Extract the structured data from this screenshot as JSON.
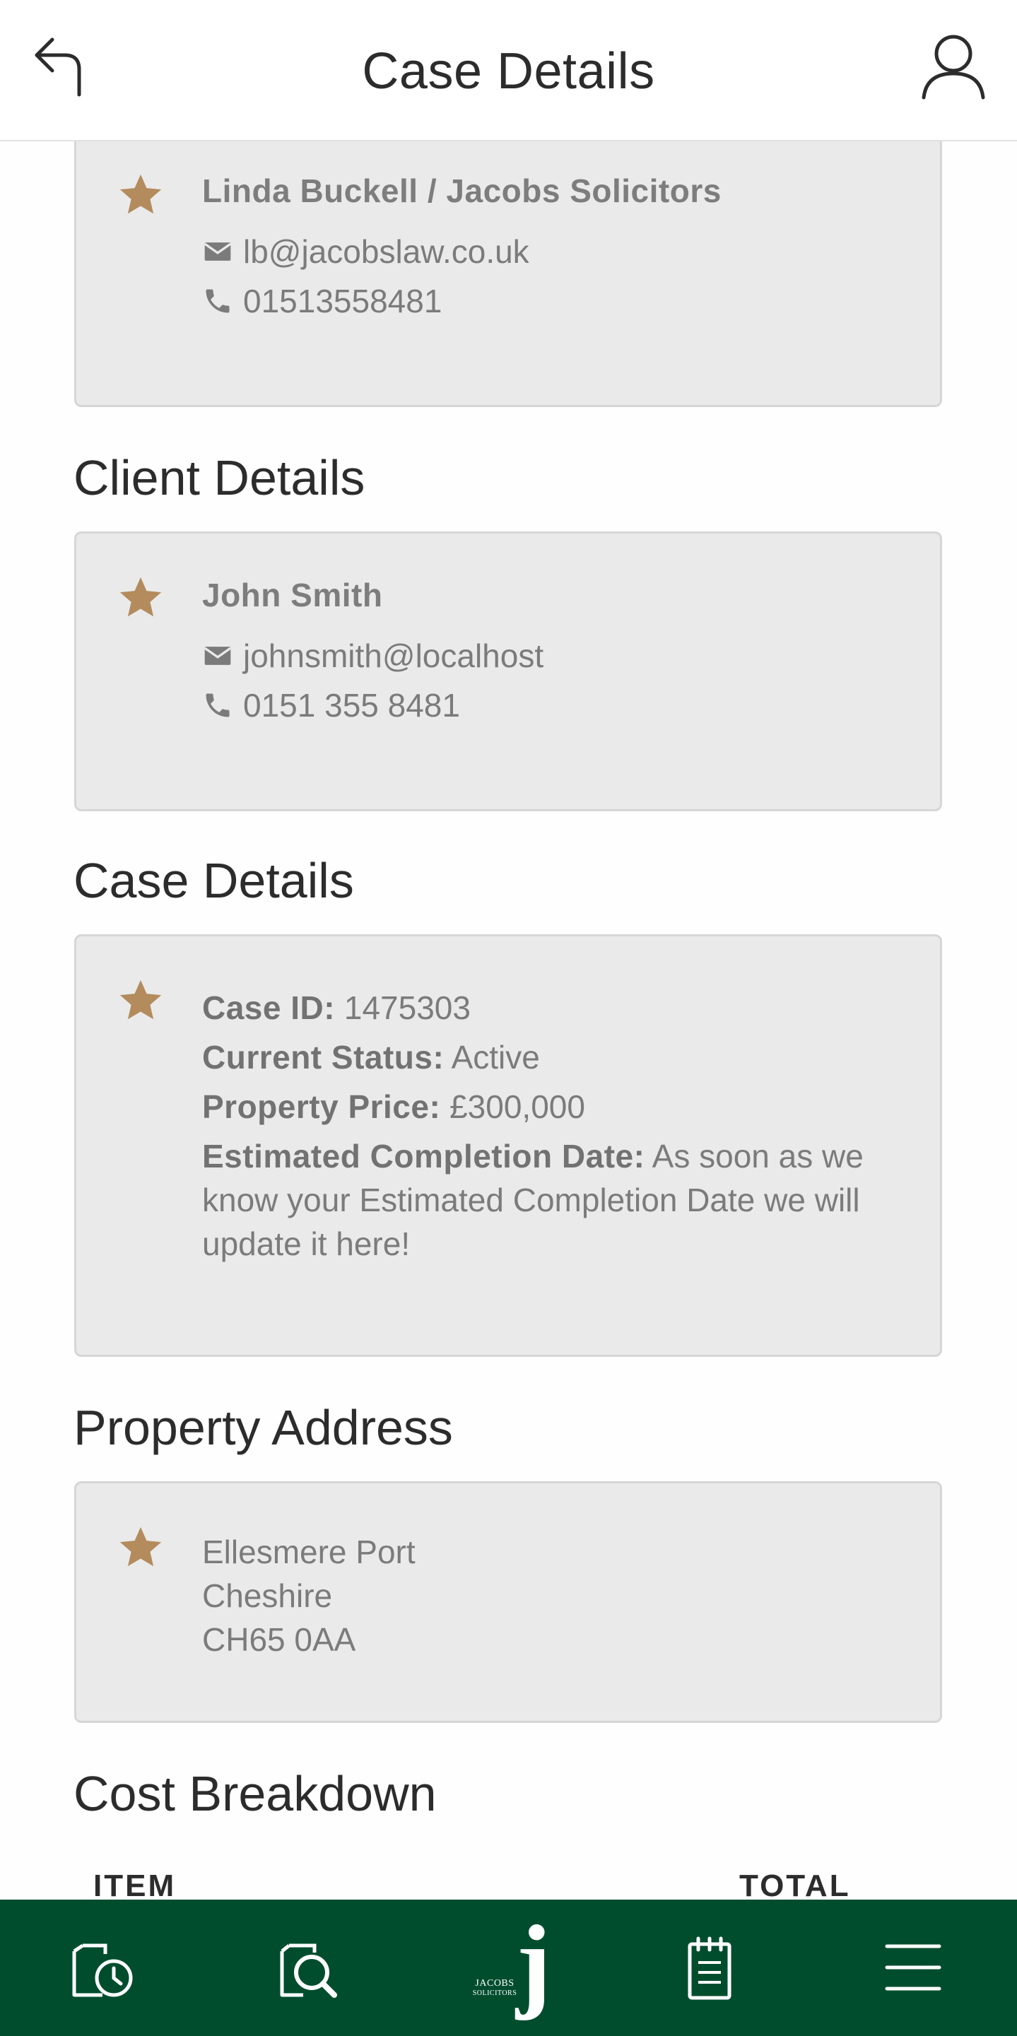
{
  "header": {
    "title": "Case Details",
    "back_icon": "back-arrow-icon",
    "profile_icon": "user-profile-icon"
  },
  "solicitor": {
    "name": "Linda Buckell / Jacobs Solicitors",
    "email": "lb@jacobslaw.co.uk",
    "phone": "01513558481"
  },
  "client_section": {
    "title": "Client Details",
    "name": "John Smith",
    "email": "johnsmith@localhost",
    "phone": "0151 355 8481"
  },
  "case_section": {
    "title": "Case Details",
    "case_id_label": "Case ID:",
    "case_id": "1475303",
    "status_label": "Current Status:",
    "status": "Active",
    "price_label": "Property Price:",
    "price": "£300,000",
    "completion_label": "Estimated Completion Date:",
    "completion_line1": "As soon as we",
    "completion_line2": "know your Estimated Completion Date we will",
    "completion_line3": "update it here!"
  },
  "address_section": {
    "title": "Property Address",
    "line1": "Ellesmere Port",
    "line2": "Cheshire",
    "line3": "CH65 0AA"
  },
  "cost_section": {
    "title": "Cost Breakdown",
    "col_item": "ITEM",
    "col_total": "TOTAL"
  },
  "bottom_nav": {
    "items": [
      {
        "icon": "document-clock-icon"
      },
      {
        "icon": "document-search-icon"
      },
      {
        "icon": "jacobs-logo"
      },
      {
        "icon": "notepad-icon"
      },
      {
        "icon": "hamburger-menu-icon"
      }
    ],
    "logo_line1": "JACOBS",
    "logo_line2": "SOLICITORS",
    "logo_letter": "j"
  },
  "colors": {
    "accent_star": "#b38b5d",
    "nav_bg": "#004d2e",
    "card_bg": "#eaeaea"
  }
}
